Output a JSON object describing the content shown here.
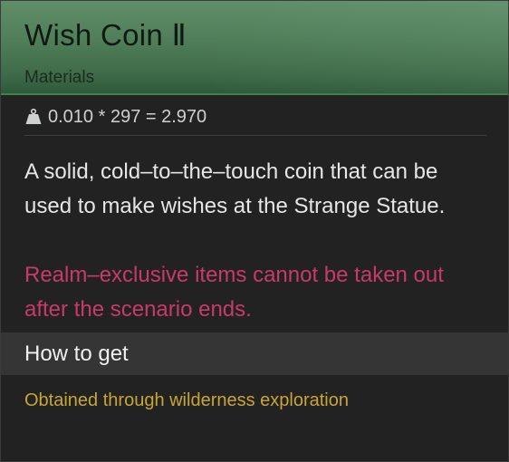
{
  "item": {
    "name": "Wish Coin Ⅱ",
    "category": "Materials",
    "weight_formula": "0.010 * 297 = 2.970",
    "description": "A solid, cold–to–the–touch coin that can be used to make wishes at the Strange Statue.",
    "warning": "Realm–exclusive items cannot be taken out after the scenario ends.",
    "how_to_get_label": "How to get",
    "source": "Obtained through wilderness exploration",
    "icon": "weight-icon",
    "colors": {
      "header": "#4f7d58",
      "warning": "#c83a6a",
      "source": "#c9a534"
    }
  }
}
